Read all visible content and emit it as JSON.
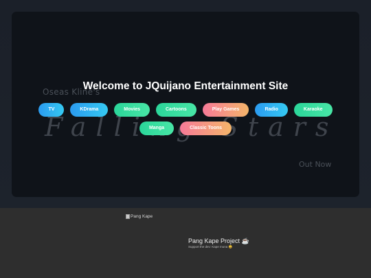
{
  "hero": {
    "welcome_title": "Welcome to JQuijano Entertainment Site",
    "background_art": {
      "artist": "Oseas Kline's",
      "title": "Falling Stars",
      "subtitle": "Out Now"
    }
  },
  "nav": {
    "row1": [
      "TV",
      "KDrama",
      "Movies",
      "Cartoons",
      "Play Games",
      "Radio",
      "Karaoke"
    ],
    "row2": [
      "Manga",
      "Classic Toons"
    ]
  },
  "colors": {
    "blue_gradient": [
      "#2b9bf0",
      "#35c9f2"
    ],
    "green_gradient": [
      "#2bd69a",
      "#48e6a6"
    ],
    "warm_gradient": [
      "#f67a98",
      "#f4b56a"
    ],
    "hero_bg": "#0f1319",
    "footer_bg": "#2e2e2e"
  },
  "footer": {
    "logo_alt": "Pang Kape",
    "project_title": "Pang Kape Project ☕",
    "project_subtitle": "Support the dev: Kape muna 😀"
  }
}
